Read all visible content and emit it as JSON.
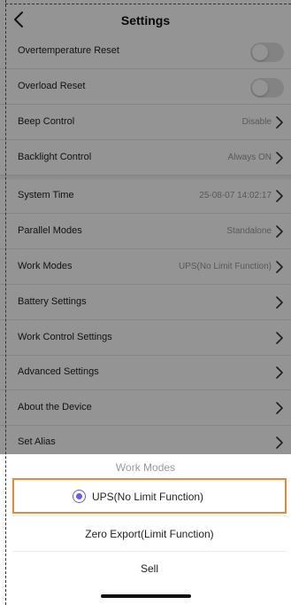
{
  "header": {
    "title": "Settings"
  },
  "settings": [
    {
      "label": "Overtemperature Reset",
      "type": "toggle",
      "on": false
    },
    {
      "label": "Overload Reset",
      "type": "toggle",
      "on": false
    },
    {
      "label": "Beep Control",
      "value": "Disable",
      "type": "link"
    },
    {
      "label": "Backlight Control",
      "value": "Always ON",
      "type": "link"
    },
    {
      "label": "System Time",
      "value": "25-08-07 14:02:17",
      "type": "link"
    },
    {
      "label": "Parallel Modes",
      "value": "Standalone",
      "type": "link"
    },
    {
      "label": "Work Modes",
      "value": "UPS(No Limit Function)",
      "type": "link"
    },
    {
      "label": "Battery Settings",
      "value": "",
      "type": "link"
    },
    {
      "label": "Work Control Settings",
      "value": "",
      "type": "link"
    },
    {
      "label": "Advanced Settings",
      "value": "",
      "type": "link"
    },
    {
      "label": "About the Device",
      "value": "",
      "type": "link"
    },
    {
      "label": "Set Alias",
      "value": "",
      "type": "link"
    }
  ],
  "sheet": {
    "title": "Work Modes",
    "options": [
      {
        "label": "UPS(No Limit Function)",
        "selected": true
      },
      {
        "label": "Zero Export(Limit Function)",
        "selected": false
      },
      {
        "label": "Sell",
        "selected": false
      }
    ]
  },
  "colors": {
    "accent": "#6b5fd3",
    "highlight": "#e8863c"
  },
  "icons": {
    "back": "chevron-left-icon",
    "row": "chevron-right-icon"
  }
}
